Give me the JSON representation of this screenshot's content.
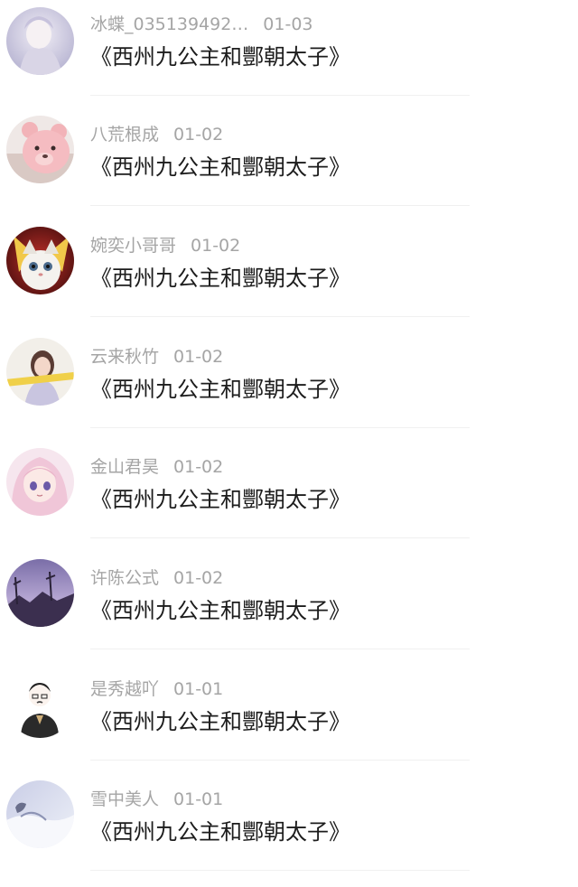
{
  "comments": [
    {
      "user": "冰蝶_035139492…",
      "date": "01-03",
      "text": "《西州九公主和酆朝太子》",
      "avatar": "avatar-girl-light"
    },
    {
      "user": "八荒根成",
      "date": "01-02",
      "text": "《西州九公主和酆朝太子》",
      "avatar": "avatar-pink-bear"
    },
    {
      "user": "婉奕小哥哥",
      "date": "01-02",
      "text": "《西州九公主和酆朝太子》",
      "avatar": "avatar-cat"
    },
    {
      "user": "云来秋竹",
      "date": "01-02",
      "text": "《西州九公主和酆朝太子》",
      "avatar": "avatar-girl-photo"
    },
    {
      "user": "金山君昊",
      "date": "01-02",
      "text": "《西州九公主和酆朝太子》",
      "avatar": "avatar-anime-girl"
    },
    {
      "user": "许陈公式",
      "date": "01-02",
      "text": "《西州九公主和酆朝太子》",
      "avatar": "avatar-purple-landscape"
    },
    {
      "user": "是秀越吖",
      "date": "01-01",
      "text": "《西州九公主和酆朝太子》",
      "avatar": "avatar-man-drawing"
    },
    {
      "user": "雪中美人",
      "date": "01-01",
      "text": "《西州九公主和酆朝太子》",
      "avatar": "avatar-snow-scene"
    }
  ]
}
